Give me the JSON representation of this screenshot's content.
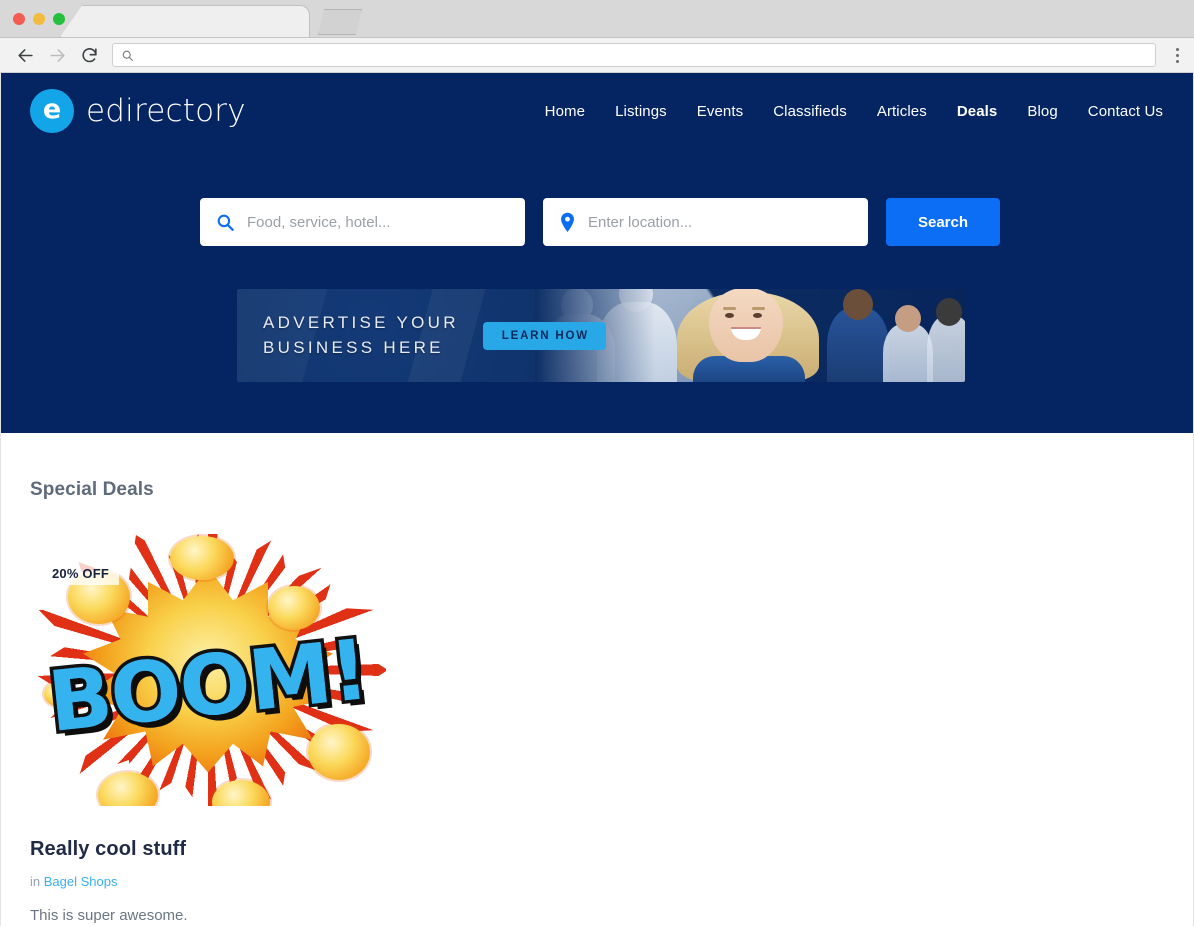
{
  "browser": {
    "tab_title": "",
    "url_value": "",
    "url_placeholder": "",
    "back_label": "Back",
    "forward_label": "Forward",
    "reload_label": "Reload",
    "menu_label": "Customize and control",
    "search_icon": "search-icon"
  },
  "site": {
    "logo_mark": "e",
    "logo_text": "edirectory",
    "nav": [
      {
        "label": "Home",
        "active": false
      },
      {
        "label": "Listings",
        "active": false
      },
      {
        "label": "Events",
        "active": false
      },
      {
        "label": "Classifieds",
        "active": false
      },
      {
        "label": "Articles",
        "active": false
      },
      {
        "label": "Deals",
        "active": true
      },
      {
        "label": "Blog",
        "active": false
      },
      {
        "label": "Contact Us",
        "active": false
      }
    ]
  },
  "search": {
    "keyword_value": "",
    "keyword_placeholder": "Food, service, hotel...",
    "keyword_icon": "search-icon",
    "location_value": "",
    "location_placeholder": "Enter location...",
    "location_icon": "map-pin-icon",
    "button_label": "Search"
  },
  "banner": {
    "headline": "ADVERTISE YOUR\nBUSINESS HERE",
    "cta_label": "LEARN HOW"
  },
  "main": {
    "section_title": "Special Deals",
    "deals": [
      {
        "badge": "20% OFF",
        "image_alt": "BOOM! comic explosion",
        "image_word": "BOOM!",
        "title": "Really cool stuff",
        "meta_prefix": "in",
        "category": "Bagel Shops",
        "description": "This is super awesome."
      }
    ]
  },
  "colors": {
    "hero_navy": "#042462",
    "accent_blue": "#0b6ef5",
    "logo_cyan": "#12a5e8",
    "link_blue": "#3ab0f0",
    "banner_cta": "#29a8e8",
    "section_title": "#5f6b7a",
    "deal_title": "#1f2a44"
  }
}
